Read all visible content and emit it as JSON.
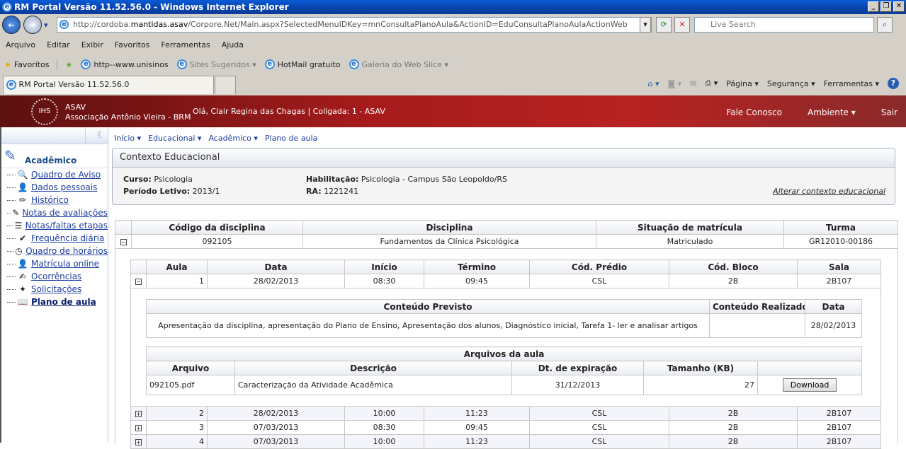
{
  "window": {
    "title": "RM Portal Versão 11.52.56.0 - Windows Internet Explorer"
  },
  "browser": {
    "url_prefix": "http://cordoba.",
    "url_domain": "mantidas.asav",
    "url_rest": "/Corpore.Net/Main.aspx?SelectedMenuIDKey=mnConsultaPlanoAula&ActionID=EduConsultaPlanoAulaActionWeb",
    "search_placeholder": "Live Search",
    "menu": [
      "Arquivo",
      "Editar",
      "Exibir",
      "Favoritos",
      "Ferramentas",
      "Ajuda"
    ],
    "favorites_label": "Favoritos",
    "favorites": [
      "http--www.unisinos",
      "Sites Sugeridos ▾",
      "HotMail gratuito",
      "Galeria do Web Slice ▾"
    ],
    "tab_title": "RM Portal Versão 11.52.56.0",
    "commands": [
      "Página ▾",
      "Segurança ▾",
      "Ferramentas ▾"
    ]
  },
  "header": {
    "org_short": "ASAV",
    "org_name": "Associação Antônio Vieira - BRM",
    "greeting": "Olá, Clair Regina das Chagas  |  Coligada: 1 - ASAV",
    "nav": [
      "Fale Conosco",
      "Ambiente ▾",
      "Sair"
    ],
    "logo_text": "IHS",
    "accent": "#b82222"
  },
  "sidebar": {
    "section": "Acadêmico",
    "items": [
      {
        "label": "Quadro de Aviso",
        "icon": "🔍"
      },
      {
        "label": "Dados pessoais",
        "icon": "👤"
      },
      {
        "label": "Histórico",
        "icon": "✏"
      },
      {
        "label": "Notas de avaliações",
        "icon": "✎"
      },
      {
        "label": "Notas/faltas etapas",
        "icon": "☰"
      },
      {
        "label": "Frequência diária",
        "icon": "✔"
      },
      {
        "label": "Quadro de horários",
        "icon": "◷"
      },
      {
        "label": "Matrícula online",
        "icon": "👤"
      },
      {
        "label": "Ocorrências",
        "icon": "✍"
      },
      {
        "label": "Solicitações",
        "icon": "✦"
      },
      {
        "label": "Plano de aula",
        "icon": "📖"
      }
    ]
  },
  "breadcrumb": [
    "Início ▾",
    "Educacional ▾",
    "Acadêmico ▾",
    "Plano de aula"
  ],
  "context": {
    "title": "Contexto Educacional",
    "curso_label": "Curso:",
    "curso": "Psicologia",
    "periodo_label": "Período Letivo:",
    "periodo": "2013/1",
    "hab_label": "Habilitação:",
    "hab": "Psicologia - Campus São Leopoldo/RS",
    "ra_label": "RA:",
    "ra": "1221241",
    "alter_link": "Alterar contexto educacional"
  },
  "disciplinas": {
    "headers": [
      "Código da disciplina",
      "Disciplina",
      "Situação de matrícula",
      "Turma"
    ],
    "row": [
      "092105",
      "Fundamentos da Clínica Psicológica",
      "Matriculado",
      "GR12010-00186"
    ]
  },
  "aulas": {
    "headers": [
      "Aula",
      "Data",
      "Início",
      "Término",
      "Cód. Prédio",
      "Cód. Bloco",
      "Sala"
    ],
    "rows": [
      [
        "1",
        "28/02/2013",
        "08:30",
        "09:45",
        "CSL",
        "2B",
        "2B107"
      ],
      [
        "2",
        "28/02/2013",
        "10:00",
        "11:23",
        "CSL",
        "2B",
        "2B107"
      ],
      [
        "3",
        "07/03/2013",
        "08:30",
        "09:45",
        "CSL",
        "2B",
        "2B107"
      ],
      [
        "4",
        "07/03/2013",
        "10:00",
        "11:23",
        "CSL",
        "2B",
        "2B107"
      ]
    ]
  },
  "conteudo": {
    "headers": [
      "Conteúdo Previsto",
      "Conteúdo Realizado",
      "Data"
    ],
    "previsto": "Apresentação da disciplina, apresentação do Plano de Ensino, Apresentação dos alunos, Diagnóstico inicial, Tarefa 1- ler e analisar artigos",
    "realizado": "",
    "data": "28/02/2013"
  },
  "arquivos": {
    "title": "Arquivos da aula",
    "headers": [
      "Arquivo",
      "Descrição",
      "Dt. de expiração",
      "Tamanho (KB)"
    ],
    "row": [
      "092105.pdf",
      "Caracterização da Atividade Acadêmica",
      "31/12/2013",
      "27"
    ],
    "download": "Download"
  }
}
